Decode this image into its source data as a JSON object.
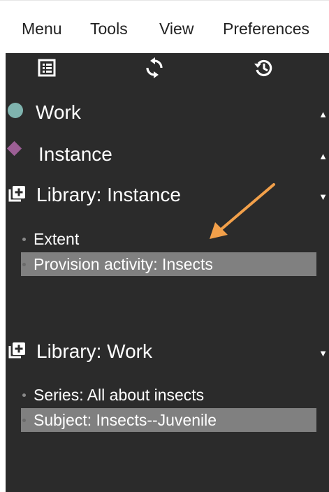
{
  "menubar": {
    "items": [
      {
        "label": "Menu"
      },
      {
        "label": "Tools"
      },
      {
        "label": "View"
      },
      {
        "label": "Preferences"
      }
    ]
  },
  "toolbar": {
    "icons": [
      "list-icon",
      "refresh-icon",
      "history-icon"
    ]
  },
  "sections": {
    "work": {
      "label": "Work",
      "chevron": "▲",
      "color": "#7fb3ae"
    },
    "instance": {
      "label": "Instance",
      "chevron": "▲",
      "color": "#9c5f95"
    },
    "library_instance": {
      "label": "Library: Instance",
      "chevron": "▼",
      "items": [
        {
          "label": "Extent",
          "selected": false
        },
        {
          "label": "Provision activity: Insects",
          "selected": true
        }
      ]
    },
    "library_work": {
      "label": "Library: Work",
      "chevron": "▼",
      "items": [
        {
          "label": "Series: All about insects",
          "selected": false
        },
        {
          "label": "Subject: Insects--Juvenile",
          "selected": true
        }
      ]
    }
  },
  "colors": {
    "panel_bg": "#2b2b2b",
    "selection_bg": "#808080",
    "annotation_arrow": "#f2a04a"
  }
}
